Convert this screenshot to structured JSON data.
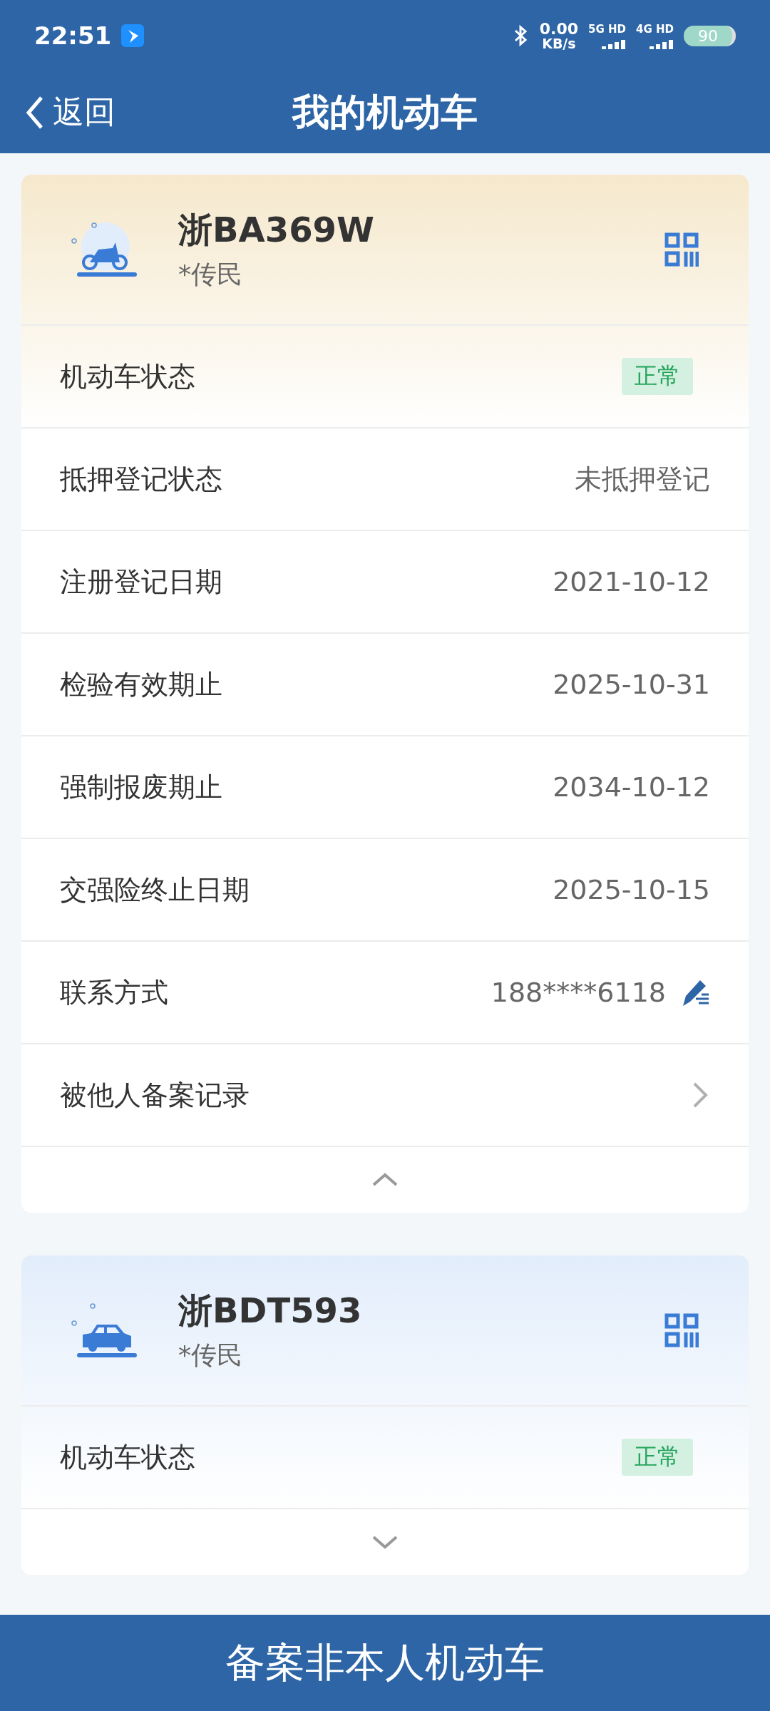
{
  "status_bar": {
    "time": "22:51",
    "speed_value": "0.00",
    "speed_unit": "KB/s",
    "sim1": "5G HD",
    "sim2": "4G HD",
    "battery": "90"
  },
  "nav": {
    "back": "返回",
    "title": "我的机动车"
  },
  "vehicles": [
    {
      "kind": "motorcycle",
      "plate": "浙BA369W",
      "owner": "*传民",
      "expanded": true,
      "rows": [
        {
          "kind": "badge",
          "label": "机动车状态",
          "value": "正常"
        },
        {
          "kind": "text",
          "label": "抵押登记状态",
          "value": "未抵押登记"
        },
        {
          "kind": "text",
          "label": "注册登记日期",
          "value": "2021-10-12"
        },
        {
          "kind": "text",
          "label": "检验有效期止",
          "value": "2025-10-31"
        },
        {
          "kind": "text",
          "label": "强制报废期止",
          "value": "2034-10-12"
        },
        {
          "kind": "text",
          "label": "交强险终止日期",
          "value": "2025-10-15"
        },
        {
          "kind": "phone",
          "label": "联系方式",
          "value": "188****6118"
        },
        {
          "kind": "link",
          "label": "被他人备案记录"
        }
      ]
    },
    {
      "kind": "car",
      "plate": "浙BDT593",
      "owner": "*传民",
      "expanded": false,
      "rows": [
        {
          "kind": "badge",
          "label": "机动车状态",
          "value": "正常"
        }
      ]
    }
  ],
  "bottom_button": "备案非本人机动车"
}
